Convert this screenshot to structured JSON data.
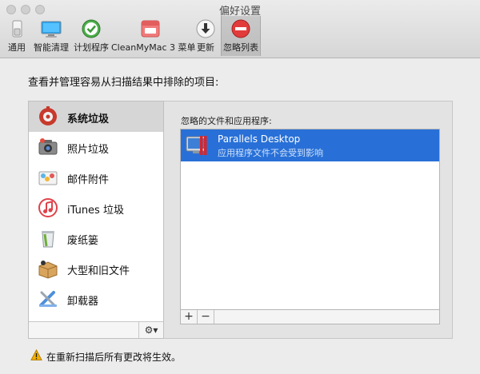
{
  "window": {
    "title": "偏好设置"
  },
  "toolbar": {
    "items": [
      {
        "label": "通用",
        "icon": "switch-icon"
      },
      {
        "label": "智能清理",
        "icon": "monitor-icon"
      },
      {
        "label": "计划程序",
        "icon": "schedule-check-icon"
      },
      {
        "label": "CleanMyMac 3 菜单",
        "icon": "menu-app-icon"
      },
      {
        "label": "更新",
        "icon": "download-arrow-icon"
      },
      {
        "label": "忽略列表",
        "icon": "no-entry-icon",
        "selected": true
      }
    ]
  },
  "main": {
    "instruction": "查看并管理容易从扫描结果中排除的项目:",
    "sidebar": {
      "items": [
        {
          "label": "系统垃圾",
          "icon": "system-junk-icon",
          "selected": true
        },
        {
          "label": "照片垃圾",
          "icon": "camera-icon"
        },
        {
          "label": "邮件附件",
          "icon": "mail-attachment-icon"
        },
        {
          "label": "iTunes 垃圾",
          "icon": "itunes-icon"
        },
        {
          "label": "废纸篓",
          "icon": "trash-icon"
        },
        {
          "label": "大型和旧文件",
          "icon": "box-icon"
        },
        {
          "label": "卸载器",
          "icon": "uninstaller-icon"
        }
      ],
      "gear_symbol": "⚙▾"
    },
    "list": {
      "label": "忽略的文件和应用程序:",
      "items": [
        {
          "title": "Parallels Desktop",
          "subtitle": "应用程序文件不会受到影响",
          "icon": "parallels-icon"
        }
      ],
      "add_symbol": "+",
      "remove_symbol": "−"
    },
    "warning": {
      "text": "在重新扫描后所有更改将生效。",
      "icon": "warning-icon"
    }
  },
  "colors": {
    "selection": "#2870d7",
    "warning": "#f5b000"
  }
}
